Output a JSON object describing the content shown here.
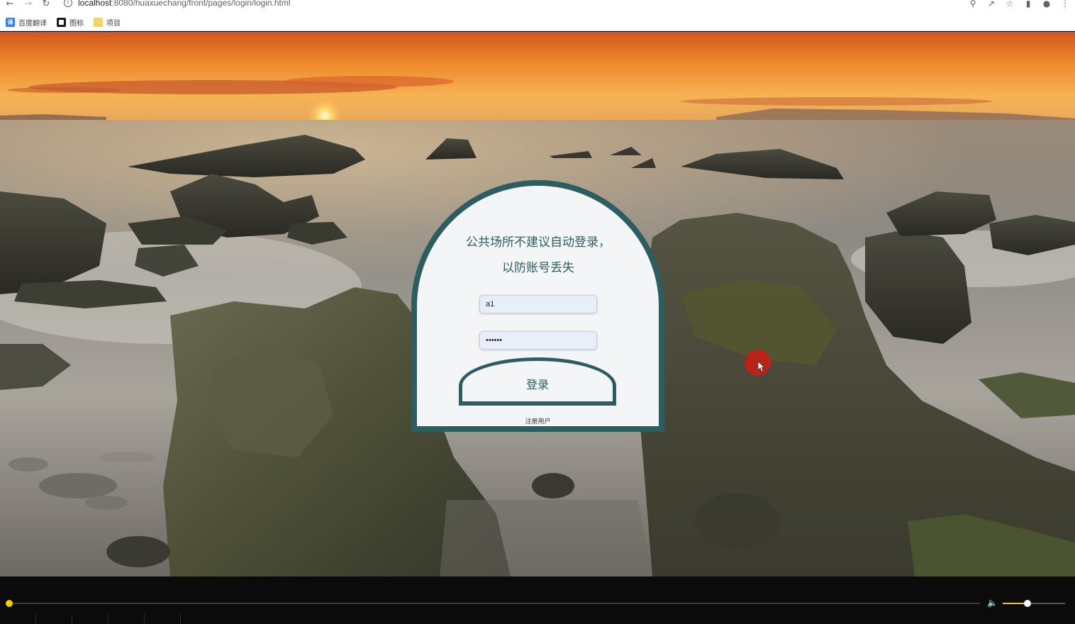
{
  "browser": {
    "url_prefix": "localhost",
    "url_rest": ":8080/huaxuechang/front/pages/login/login.html",
    "bookmarks": [
      {
        "label": "百度翻译",
        "icon": "translate-icon"
      },
      {
        "label": "图标",
        "icon": "iconfont-icon"
      },
      {
        "label": "项目",
        "icon": "folder-icon"
      }
    ]
  },
  "login": {
    "title": "公共场所不建议自动登录，以防账号丢失",
    "username_value": "a1",
    "password_value": "••••••",
    "login_button": "登录",
    "register_link": "注册用户"
  },
  "player": {
    "progress": 0.0,
    "volume": 0.4
  },
  "colors": {
    "card_border": "#2e5d61",
    "card_bg": "#f4f5f6",
    "accent": "#f7c900"
  }
}
